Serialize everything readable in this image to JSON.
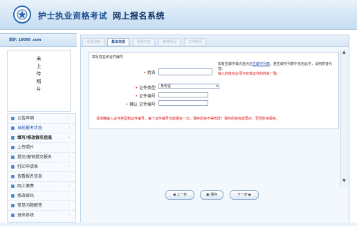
{
  "header": {
    "title_part1": "护士执业资格考试",
    "title_part2": "网上报名系统"
  },
  "userbar": {
    "text": "您好: 10000 .com"
  },
  "photo": {
    "placeholder": "未上传照片"
  },
  "sidebar": {
    "items": [
      {
        "label": "公告声明",
        "icon": "speaker-icon"
      },
      {
        "label": "当前报考状态",
        "icon": "doc-icon"
      },
      {
        "label": "填写/修改报名信息",
        "icon": "edit-icon"
      },
      {
        "label": "上传照片",
        "icon": "photo-icon"
      },
      {
        "label": "提交/撤销提交报名",
        "icon": "submit-icon"
      },
      {
        "label": "打印申请表",
        "icon": "print-icon"
      },
      {
        "label": "查看报名信息",
        "icon": "view-icon"
      },
      {
        "label": "网上缴费",
        "icon": "pay-icon"
      },
      {
        "label": "修改密码",
        "icon": "key-icon"
      },
      {
        "label": "常见问题解答",
        "icon": "help-icon"
      },
      {
        "label": "退出系统",
        "icon": "exit-icon"
      }
    ]
  },
  "tabs": [
    {
      "label": "考试须知",
      "active": false
    },
    {
      "label": "基本信息",
      "active": true
    },
    {
      "label": "报名信息",
      "active": false
    },
    {
      "label": "教育情况",
      "active": false
    },
    {
      "label": "工作情况",
      "active": false
    }
  ],
  "form": {
    "section_title": "填写姓名和证件编号",
    "name_label": "姓名",
    "id_type_label": "证件类型",
    "id_type_value": "身份证",
    "id_number_label": "证件编号",
    "id_confirm_label": "确认 证件编号",
    "hint_text": "如有生僻字或点选点击",
    "hint_link": "生僻字列表",
    "hint_text2": "，若生僻字列表中也无此字，请用拼音代替。",
    "hint_red": "输入的姓名必须与有效证件的姓名一致。",
    "notice": "请准确输入证件类型和证件编号，每个证件编号仅能报名一次，保存后将不得修改！保存后将有效再办，否则影响报名。"
  },
  "buttons": {
    "prev": "上一步",
    "save": "保存",
    "next": "下一步"
  }
}
